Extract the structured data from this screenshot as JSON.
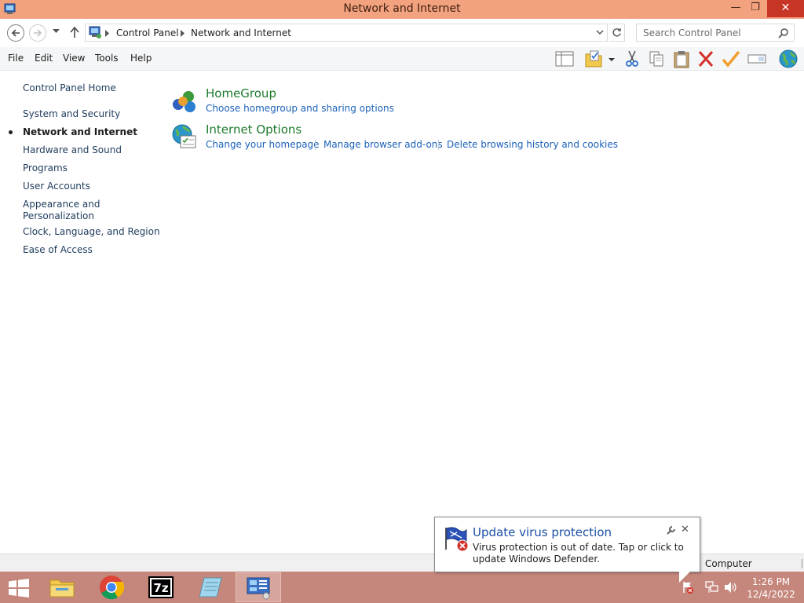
{
  "window": {
    "title": "Network and Internet",
    "minimize_glyph": "—",
    "restore_glyph": "❐",
    "close_glyph": "✕"
  },
  "address_bar": {
    "breadcrumbs": [
      "Control Panel",
      "Network and Internet"
    ],
    "search_placeholder": "Search Control Panel"
  },
  "menu": [
    "File",
    "Edit",
    "View",
    "Tools",
    "Help"
  ],
  "toolbar_icons": [
    "layout-pane-icon",
    "folder-check-icon",
    "dropdown-arrow-icon",
    "cut-icon",
    "copy-icon",
    "paste-icon",
    "delete-icon",
    "checkmark-icon",
    "rename-icon",
    "globe-icon"
  ],
  "left_nav": {
    "home": "Control Panel Home",
    "items": [
      "System and Security",
      "Network and Internet",
      "Hardware and Sound",
      "Programs",
      "User Accounts",
      "Appearance and Personalization",
      "Clock, Language, and Region",
      "Ease of Access"
    ],
    "active_index": 1
  },
  "categories": [
    {
      "title": "HomeGroup",
      "links": [
        "Choose homegroup and sharing options"
      ],
      "icon": "homegroup-icon"
    },
    {
      "title": "Internet Options",
      "links": [
        "Change your homepage",
        "Manage browser add-ons",
        "Delete browsing history and cookies"
      ],
      "icon": "internet-options-icon"
    }
  ],
  "status_bar": {
    "location": "Computer"
  },
  "notification": {
    "title": "Update virus protection",
    "text": "Virus protection is out of date. Tap or click to update Windows Defender."
  },
  "taskbar": {
    "apps": [
      "file-explorer-icon",
      "chrome-icon",
      "7zip-icon",
      "notepad-icon",
      "control-panel-icon"
    ],
    "active_app": "control-panel-icon",
    "time": "1:26 PM",
    "date": "12/4/2022"
  },
  "colors": {
    "titlebar": "#f2a27e",
    "taskbar": "#c5877c",
    "link": "#1c62b9",
    "category_title": "#1e7a2d"
  }
}
